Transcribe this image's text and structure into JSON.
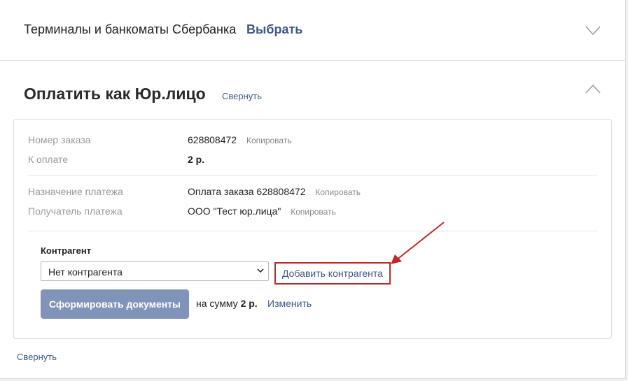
{
  "terminals": {
    "title": "Терминалы и банкоматы Сбербанка",
    "choose_label": "Выбрать"
  },
  "pay": {
    "title": "Оплатить как Юр.лицо",
    "collapse_label": "Свернуть"
  },
  "details": {
    "order_number": {
      "label": "Номер заказа",
      "value": "628808472",
      "copy_label": "Копировать"
    },
    "to_pay": {
      "label": "К оплате",
      "value": "2 р."
    },
    "purpose": {
      "label": "Назначение платежа",
      "value": "Оплата заказа 628808472",
      "copy_label": "Копировать"
    },
    "recipient": {
      "label": "Получатель платежа",
      "value": "ООО \"Тест юр.лица\"",
      "copy_label": "Копировать"
    }
  },
  "counterparty": {
    "label": "Контрагент",
    "selected": "Нет контрагента",
    "add_label": "Добавить контрагента"
  },
  "actions": {
    "form_docs_label": "Сформировать документы",
    "sum_prefix": "на сумму",
    "sum_value": "2 р.",
    "change_label": "Изменить"
  },
  "footer": {
    "collapse_label": "Свернуть"
  },
  "colors": {
    "link": "#3e5a86",
    "button": "#8094ba",
    "annotation": "#c22626"
  }
}
